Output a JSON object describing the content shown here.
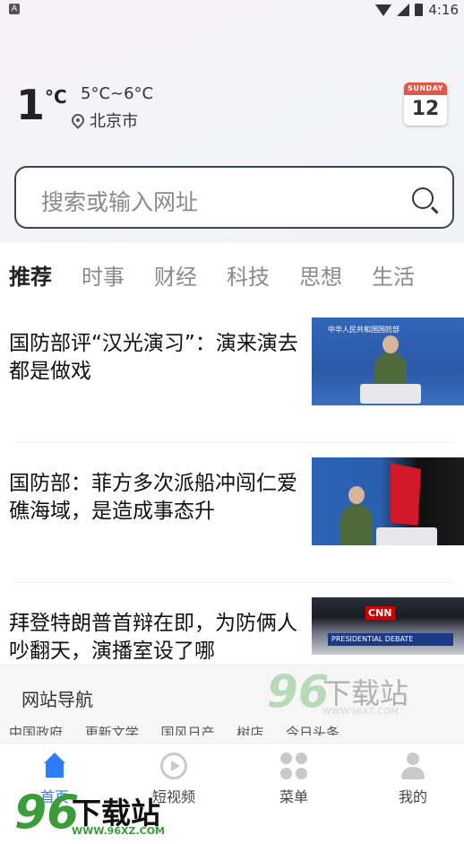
{
  "status_bar": {
    "sim_icon": "A",
    "time": "4:16",
    "icons": [
      "wifi-icon",
      "signal-icon",
      "battery-icon"
    ]
  },
  "weather": {
    "temperature": "1",
    "unit": "°C",
    "range": "5°C~6°C",
    "location": "北京市",
    "location_icon": "location-pin-icon"
  },
  "calendar": {
    "weekday": "SUNDAY",
    "day": "12"
  },
  "search": {
    "placeholder": "搜索或输入网址",
    "icon": "search-icon"
  },
  "tabs": [
    "推荐",
    "时事",
    "财经",
    "科技",
    "思想",
    "生活"
  ],
  "active_tab": "推荐",
  "news": [
    {
      "title": "国防部评“汉光演习”：演来演去都是做戏",
      "thumb_caption": "中华人民共和国国防部"
    },
    {
      "title": "国防部：菲方多次派船冲闯仁爱礁海域，是造成事态升",
      "thumb_caption": ""
    },
    {
      "title": "拜登特朗普首辩在即，为防俩人吵翻天，演播室设了哪",
      "thumb_caption": "CNN",
      "thumb_bar": "PRESIDENTIAL DEBATE"
    }
  ],
  "site_nav": {
    "label": "网站导航",
    "links_partial": "中国政府 更新文学 国风日产 树店 今日头条"
  },
  "watermark": {
    "number": "96",
    "text": "下载站",
    "url": "WWW.96XZ.COM"
  },
  "bottom_nav": [
    {
      "label": "首页",
      "icon": "home-icon",
      "active": true
    },
    {
      "label": "短视频",
      "icon": "play-icon",
      "active": false
    },
    {
      "label": "菜单",
      "icon": "menu-icon",
      "active": false
    },
    {
      "label": "我的",
      "icon": "user-icon",
      "active": false
    }
  ],
  "colors": {
    "accent": "#2f7df6",
    "calendar_red": "#e2564a",
    "watermark_green": "#3a9d3a"
  }
}
